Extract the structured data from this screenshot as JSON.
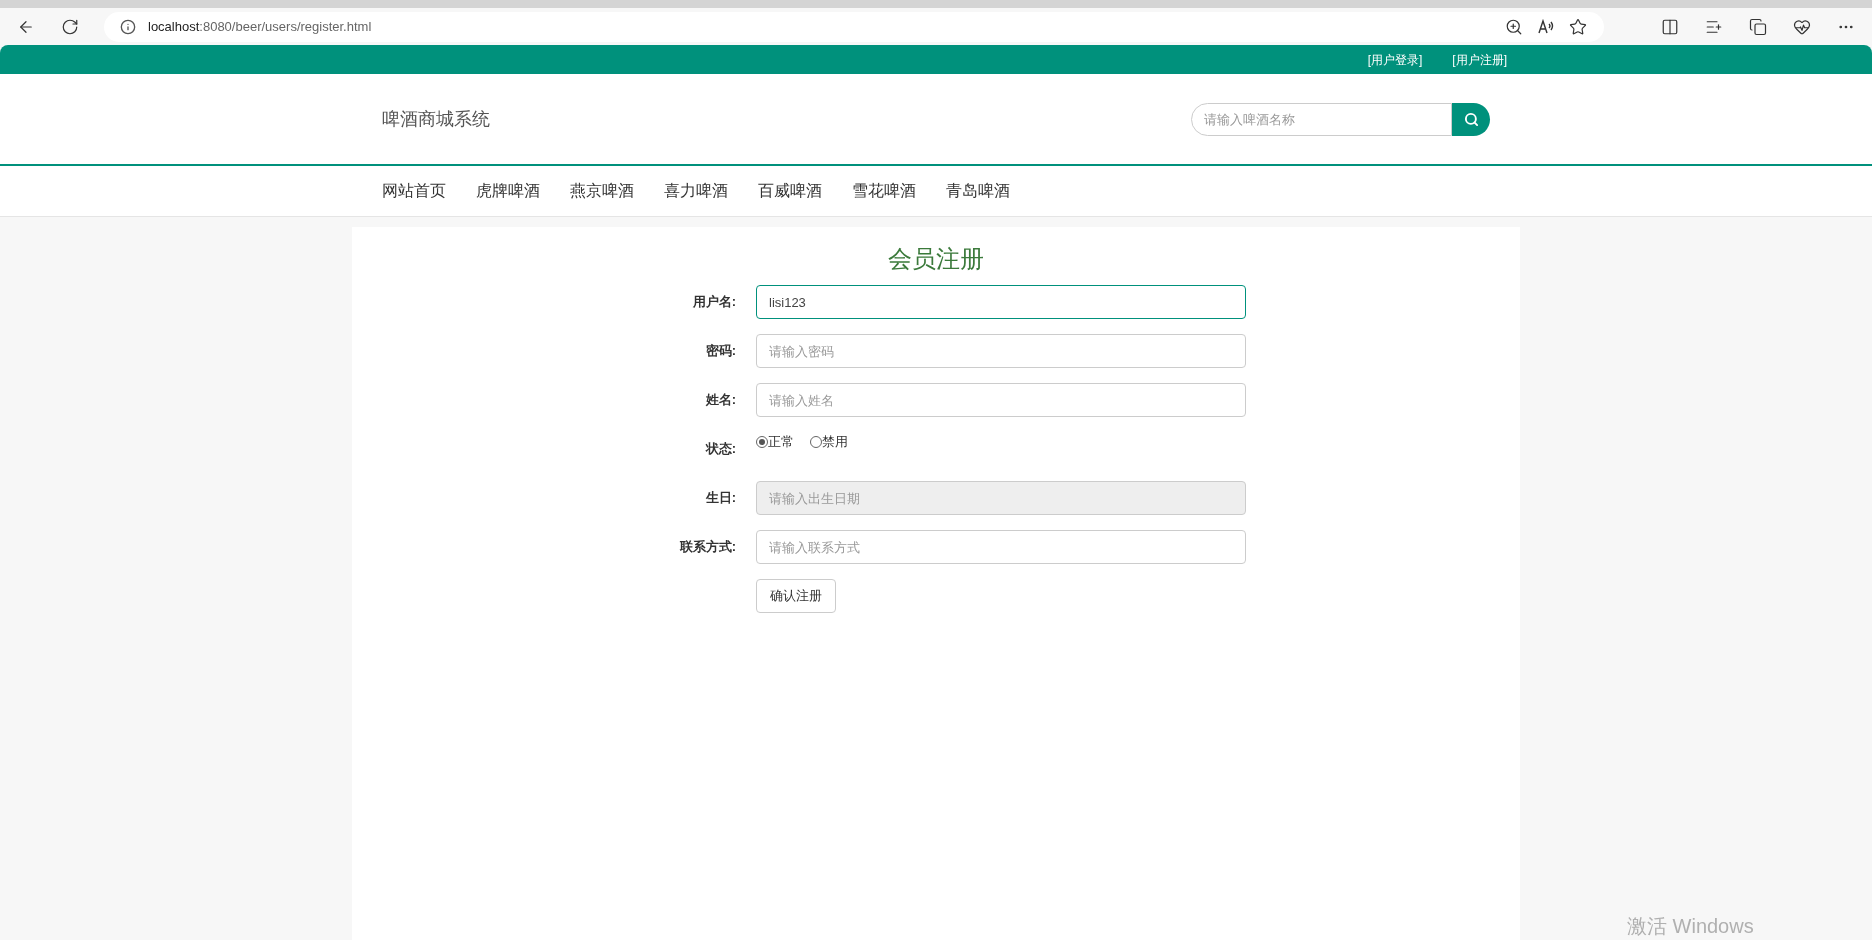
{
  "browser": {
    "url_host": "localhost",
    "url_path": ":8080/beer/users/register.html"
  },
  "top_links": [
    "[用户登录]",
    "[用户注册]"
  ],
  "header": {
    "site_name": "啤酒商城系统",
    "search": {
      "placeholder": "请输入啤酒名称"
    }
  },
  "nav": [
    "网站首页",
    "虎牌啤酒",
    "燕京啤酒",
    "喜力啤酒",
    "百威啤酒",
    "雪花啤酒",
    "青岛啤酒"
  ],
  "form": {
    "title": "会员注册",
    "fields": [
      {
        "kind": "text",
        "label": "用户名:",
        "value": "lisi123",
        "focused": true,
        "disabled": false
      },
      {
        "kind": "text",
        "label": "密码:",
        "placeholder": "请输入密码",
        "focused": false,
        "disabled": false
      },
      {
        "kind": "text",
        "label": "姓名:",
        "placeholder": "请输入姓名",
        "focused": false,
        "disabled": false
      },
      {
        "kind": "radio",
        "label": "状态:",
        "options": [
          {
            "label": "正常",
            "selected": true
          },
          {
            "label": "禁用",
            "selected": false
          }
        ]
      },
      {
        "kind": "text",
        "label": "生日:",
        "placeholder": "请输入出生日期",
        "focused": false,
        "disabled": true
      },
      {
        "kind": "text",
        "label": "联系方式:",
        "placeholder": "请输入联系方式",
        "focused": false,
        "disabled": false
      }
    ],
    "submit": "确认注册"
  },
  "os_notice": "激活 Windows"
}
